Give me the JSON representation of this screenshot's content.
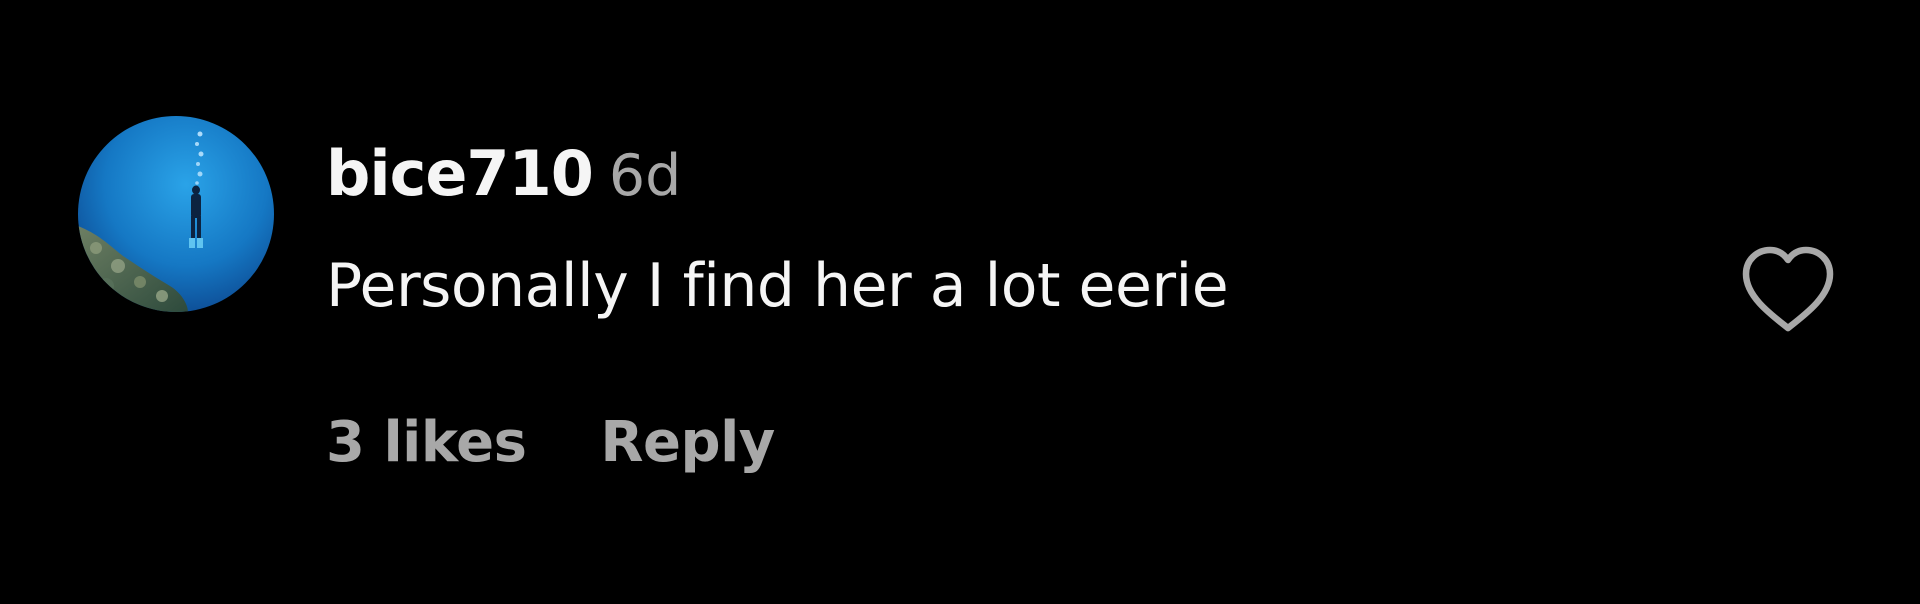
{
  "comment": {
    "username": "bice710",
    "time_ago": "6d",
    "text": "Personally I find her a lot eerie",
    "likes_label": "3 likes",
    "reply_label": "Reply",
    "like_icon": "heart-outline-icon",
    "avatar_description_icon": "scuba-diver-avatar"
  },
  "colors": {
    "background": "#000000",
    "primary_text": "#f5f5f5",
    "secondary_text": "#a8a8a8",
    "heart_outline": "#a8a8a8",
    "avatar_ocean": "#1b6fb8"
  }
}
